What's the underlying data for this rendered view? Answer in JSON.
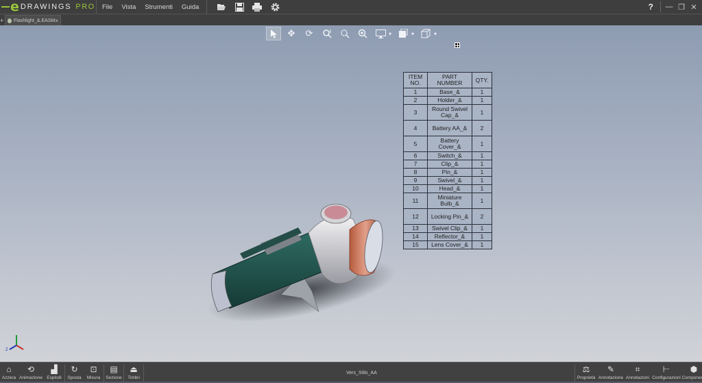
{
  "app": {
    "logo_letter": "e",
    "logo_name": "DRAWINGS",
    "logo_edition": "PRO"
  },
  "menu": {
    "items": [
      "File",
      "Vista",
      "Strumenti",
      "Guida"
    ]
  },
  "toolbar_icons": [
    "open-icon",
    "save-icon",
    "print-icon",
    "settings-icon"
  ],
  "window_controls": {
    "help": "?",
    "minimize": "—",
    "restore": "❐",
    "close": "✕"
  },
  "tab": {
    "label": "Flashlight_&.EASM",
    "close": "×",
    "new_tab": "+"
  },
  "view_toolbar": {
    "tools": [
      "select",
      "pan",
      "rotate",
      "zoom-to-fit",
      "zoom-to-area",
      "zoom-in-out",
      "display-style",
      "views",
      "view-orientation"
    ]
  },
  "bom": {
    "headers": [
      "ITEM NO.",
      "PART NUMBER",
      "QTY."
    ],
    "rows": [
      {
        "item": "1",
        "part": "Base_&",
        "qty": "1"
      },
      {
        "item": "2",
        "part": "Holder_&",
        "qty": "1"
      },
      {
        "item": "3",
        "part": "Round Swivel Cap_&",
        "qty": "1"
      },
      {
        "item": "4",
        "part": "Battery AA_&",
        "qty": "2"
      },
      {
        "item": "5",
        "part": "Battery Cover_&",
        "qty": "1"
      },
      {
        "item": "6",
        "part": "Switch_&",
        "qty": "1"
      },
      {
        "item": "7",
        "part": "Clip_&",
        "qty": "1"
      },
      {
        "item": "8",
        "part": "Pin_&",
        "qty": "1"
      },
      {
        "item": "9",
        "part": "Swivel_&",
        "qty": "1"
      },
      {
        "item": "10",
        "part": "Head_&",
        "qty": "1"
      },
      {
        "item": "11",
        "part": "Miniature Bulb_&",
        "qty": "1"
      },
      {
        "item": "12",
        "part": "Locking Pin_&",
        "qty": "2"
      },
      {
        "item": "13",
        "part": "Swivel Clip_&",
        "qty": "1"
      },
      {
        "item": "14",
        "part": "Reflector_&",
        "qty": "1"
      },
      {
        "item": "15",
        "part": "Lens Cover_&",
        "qty": "1"
      }
    ]
  },
  "triad": {
    "x": "X",
    "y": "Y",
    "z": "Z"
  },
  "bottom_left": [
    {
      "label": "Azzera",
      "icon": "home-icon"
    },
    {
      "label": "Animazione",
      "icon": "animation-icon"
    },
    {
      "label": "Esplodi",
      "icon": "explode-icon"
    },
    {
      "label": "Sposta",
      "icon": "move-icon"
    },
    {
      "label": "Misura",
      "icon": "measure-icon"
    },
    {
      "label": "Sezione",
      "icon": "section-icon"
    },
    {
      "label": "Timbri",
      "icon": "stamp-icon"
    }
  ],
  "status_text": "Vers_Stilo_AA",
  "bottom_right": [
    {
      "label": "Proprietà",
      "icon": "properties-icon"
    },
    {
      "label": "Annotazione",
      "icon": "pencil-icon"
    },
    {
      "label": "Annotazioni",
      "icon": "annotations-icon"
    },
    {
      "label": "Configurazioni",
      "icon": "configurations-icon"
    },
    {
      "label": "Componenti",
      "icon": "components-icon"
    }
  ]
}
